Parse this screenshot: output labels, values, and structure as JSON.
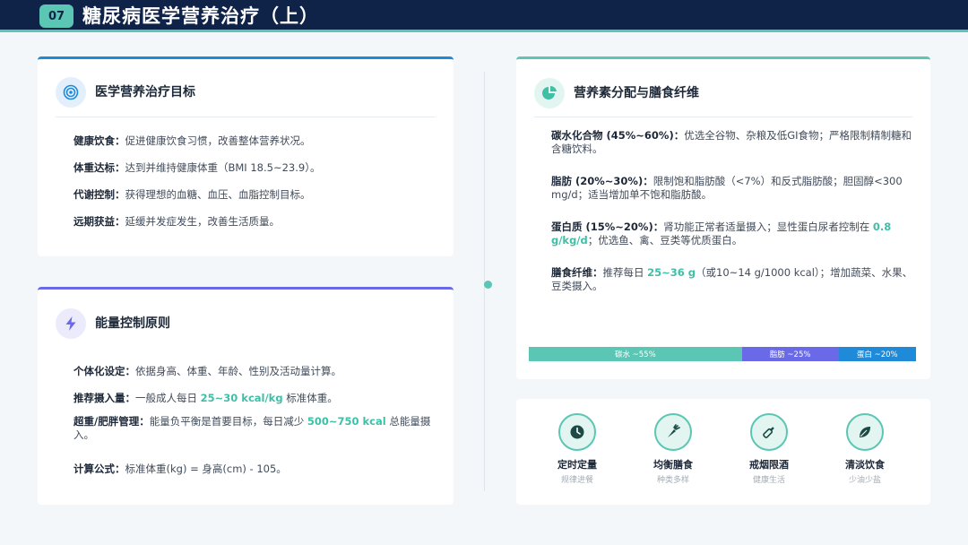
{
  "header": {
    "number": "07",
    "title": "糖尿病医学营养治疗（上）"
  },
  "goals": {
    "title": "医学营养治疗目标",
    "icon": "target-icon",
    "items": [
      {
        "label": "健康饮食",
        "sep": "：",
        "text": "促进健康饮食习惯，改善整体营养状况。"
      },
      {
        "label": "体重达标",
        "sep": "：",
        "text": "达到并维持健康体重（BMI 18.5~23.9）。"
      },
      {
        "label": "代谢控制",
        "sep": "：",
        "text": "获得理想的血糖、血压、血脂控制目标。"
      },
      {
        "label": "远期获益",
        "sep": "：",
        "text": "延缓并发症发生，改善生活质量。"
      }
    ]
  },
  "energy": {
    "title": "能量控制原则",
    "icon": "lightning-bolt-icon",
    "items": [
      {
        "label": "个体化设定",
        "sep": "：",
        "pre": "依据身高、体重、年龄、性别及活动量计算。",
        "hl": "",
        "post": ""
      },
      {
        "label": "推荐摄入量",
        "sep": "：",
        "pre": "一般成人每日 ",
        "hl": "25~30 kcal/kg",
        "post": " 标准体重。"
      },
      {
        "label": "超重/肥胖管理",
        "sep": "：",
        "pre": "能量负平衡是首要目标，每日减少 ",
        "hl": "500~750 kcal",
        "post": " 总能量摄入。"
      },
      {
        "label": "计算公式",
        "sep": "：",
        "pre": "标准体重(kg) = 身高(cm) - 105。",
        "hl": "",
        "post": ""
      }
    ]
  },
  "nutrients": {
    "title": "营养素分配与膳食纤维",
    "icon": "pie-chart-icon",
    "items": [
      {
        "label": "碳水化合物 (45%~60%)",
        "sep": "：",
        "pre": "优选全谷物、杂粮及低GI食物；严格限制精制糖和含糖饮料。",
        "hl": "",
        "post": ""
      },
      {
        "label": "脂肪 (20%~30%)",
        "sep": "：",
        "pre": "限制饱和脂肪酸（<7%）和反式脂肪酸；胆固醇<300 mg/d；适当增加单不饱和脂肪酸。",
        "hl": "",
        "post": ""
      },
      {
        "label": "蛋白质 (15%~20%)",
        "sep": "：",
        "pre": "肾功能正常者适量摄入；显性蛋白尿者控制在 ",
        "hl": "0.8 g/kg/d",
        "post": "；优选鱼、禽、豆类等优质蛋白。"
      },
      {
        "label": "膳食纤维",
        "sep": "：",
        "pre": "推荐每日 ",
        "hl": "25~36 g",
        "post": "（或10~14 g/1000 kcal）；增加蔬菜、水果、豆类摄入。"
      }
    ],
    "bar": [
      {
        "label": "碳水 ~55%",
        "value": 55,
        "color": "#5cc6b4"
      },
      {
        "label": "脂肪 ~25%",
        "value": 25,
        "color": "#6a6ae8"
      },
      {
        "label": "蛋白 ~20%",
        "value": 20,
        "color": "#1f8ad8"
      }
    ]
  },
  "tips": [
    {
      "label": "定时定量",
      "sub": "规律进餐",
      "icon": "clock-icon"
    },
    {
      "label": "均衡膳食",
      "sub": "种类多样",
      "icon": "carrot-icon"
    },
    {
      "label": "戒烟限酒",
      "sub": "健康生活",
      "icon": "bottle-icon"
    },
    {
      "label": "清淡饮食",
      "sub": "少油少盐",
      "icon": "leaf-icon"
    }
  ]
}
